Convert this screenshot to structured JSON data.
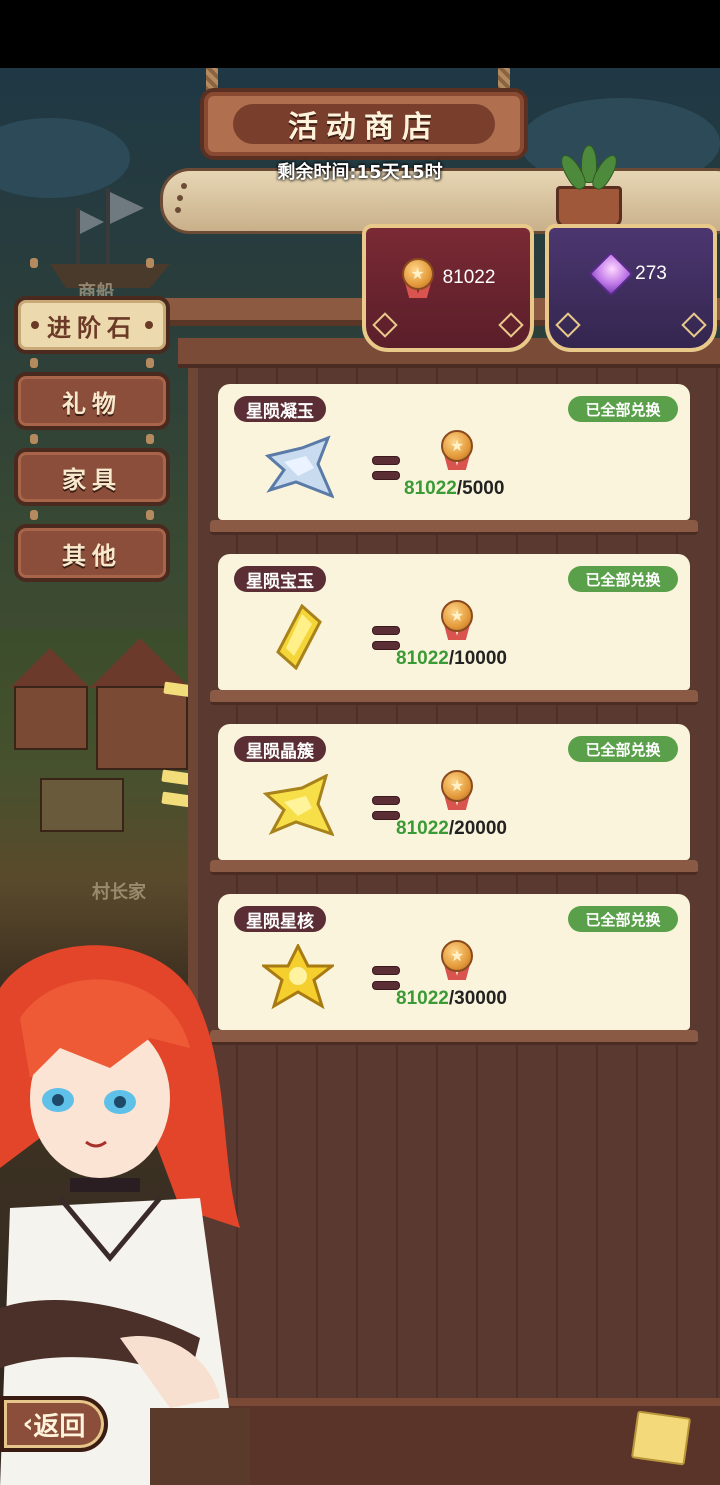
{
  "shop": {
    "title": "活动商店",
    "time_left": "剩余时间:15天15时"
  },
  "currencies": [
    {
      "icon": "bronze-medal-icon",
      "value": "81022"
    },
    {
      "icon": "purple-gem-icon",
      "value": "273"
    }
  ],
  "tabs": [
    {
      "label": "进阶石",
      "active": true
    },
    {
      "label": "礼物",
      "active": false
    },
    {
      "label": "家具",
      "active": false
    },
    {
      "label": "其他",
      "active": false
    }
  ],
  "items": [
    {
      "name": "星陨凝玉",
      "status": "已全部兑换",
      "icon": "silver-star-shard-icon",
      "have": "81022",
      "price": "/5000"
    },
    {
      "name": "星陨宝玉",
      "status": "已全部兑换",
      "icon": "yellow-crystal-icon",
      "have": "81022",
      "price": "/10000"
    },
    {
      "name": "星陨晶簇",
      "status": "已全部兑换",
      "icon": "yellow-star-shard-icon",
      "have": "81022",
      "price": "/20000"
    },
    {
      "name": "星陨星核",
      "status": "已全部兑换",
      "icon": "golden-star-core-icon",
      "have": "81022",
      "price": "/30000"
    }
  ],
  "background_labels": [
    "村长家",
    "商船"
  ],
  "back_button": "返回",
  "colors": {
    "have_amount": "#3a9a36",
    "status_button": "#5aa04a",
    "name_pill": "#5a2e34",
    "card_bg": "#fbf4dc"
  }
}
